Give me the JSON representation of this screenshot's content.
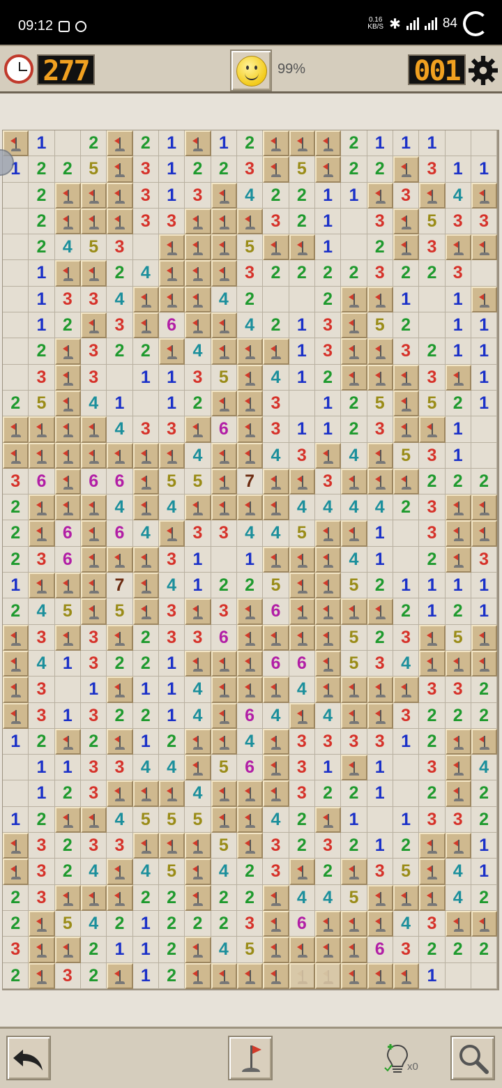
{
  "status_bar": {
    "time": "09:12",
    "speed_value": "0.16",
    "speed_unit": "KB/S",
    "battery": "84",
    "network_labels": [
      "4G",
      "4G"
    ]
  },
  "header": {
    "timer": "277",
    "completion": "99%",
    "mines_left": "001"
  },
  "footer": {
    "hint_count": "x0"
  },
  "board": {
    "columns": 19,
    "legend": "F = flagged cell, f = faded flag, . = empty revealed, digits = adjacent mine count",
    "rows": [
      "F1.2F21F12FFF2111..",
      "1225F31223F5F22F311",
      ".2FFF313F42211F3F4F1",
      ".2FFF33FFF321.3F533",
      ".2453.FFF5FF1.2F3FF",
      ".1FF24FFF322223223",
      ".1334FFF42..2FF1.1F",
      ".12F3F6FF4213F52.11",
      ".2F322F4FFF13FF3211",
      ".3F3.113 5F412FFF3F1",
      "25F41.12FF3.125F521",
      "FFFF433F6F3112 3FF1.",
      "FFFFFFF4FF43F4F531.",
      "36F66F55F7FF3FFF222",
      "2FFF4F4FFFF4444 23FF",
      "2F6F64F334 45FF1.3FF",
      "236FFF31.1FFF41.2F3",
      "1FFF7F41225FF521111",
      "245F5F3F3F6FFFF2121",
      "F3F3F2336FFFF523F5F",
      "F413221FFF66F534FFF",
      "F3.1F11 4FFF4FFFF332",
      "F3132214F64F4FF3222",
      "12F2F12FF4F3333 12FF",
      ".113344F56F31F1.3F4",
      ".123FFF4FFF3221.2F2",
      "12FF4555FF42F1.133 2",
      "F3233FFF5F323212FF1",
      "F324F45F423F2F35F41",
      "23FFF22F22F445FFF42",
      "2F5421222 3F6FFF43FF",
      "3FF2112F45FFFF6322 2",
      "2F32F12FFFFffFFF1.."
    ]
  }
}
